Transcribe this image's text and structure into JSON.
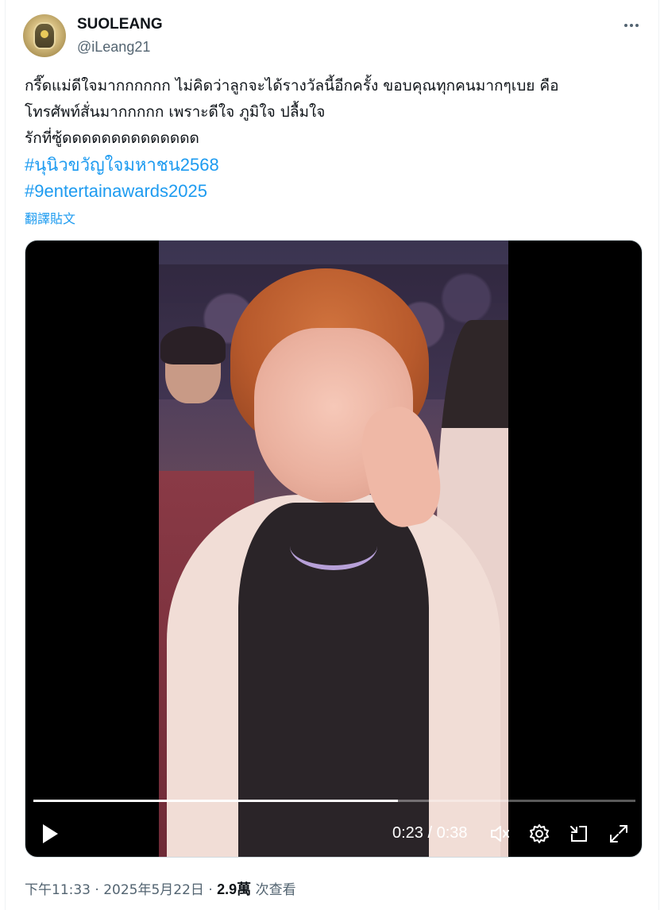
{
  "author": {
    "display_name": "SUOLEANG",
    "handle": "@iLeang21"
  },
  "tweet": {
    "lines": [
      "กรี๊ดแม่ดีใจมากกกกกก ไม่คิดว่าลูกจะได้รางวัลนี้อีกครั้ง ขอบคุณทุกคนมากๆเบย คือ",
      "โทรศัพท์สั่นมากกกกก เพราะดีใจ ภูมิใจ ปลื้มใจ",
      "รักที่ซู้ดดดดดดดดดดดดดด"
    ],
    "hashtags": [
      "#นุนิวขวัญใจมหาชน2568",
      "#9entertainawards2025"
    ],
    "translate_label": "翻譯貼文"
  },
  "video": {
    "current_time": "0:23",
    "separator": " / ",
    "duration": "0:38",
    "progress_fraction": 0.605
  },
  "footer": {
    "time": "下午11:33",
    "sep1": " · ",
    "date": "2025年5月22日",
    "sep2": " · ",
    "views_count": "2.9萬",
    "views_label": " 次查看"
  },
  "colors": {
    "link": "#1d9bf0",
    "secondary_text": "#536471",
    "primary_text": "#0f1419"
  },
  "icons": [
    "more-icon",
    "play-icon",
    "volume-icon",
    "settings-icon",
    "picture-in-picture-icon",
    "fullscreen-icon"
  ]
}
